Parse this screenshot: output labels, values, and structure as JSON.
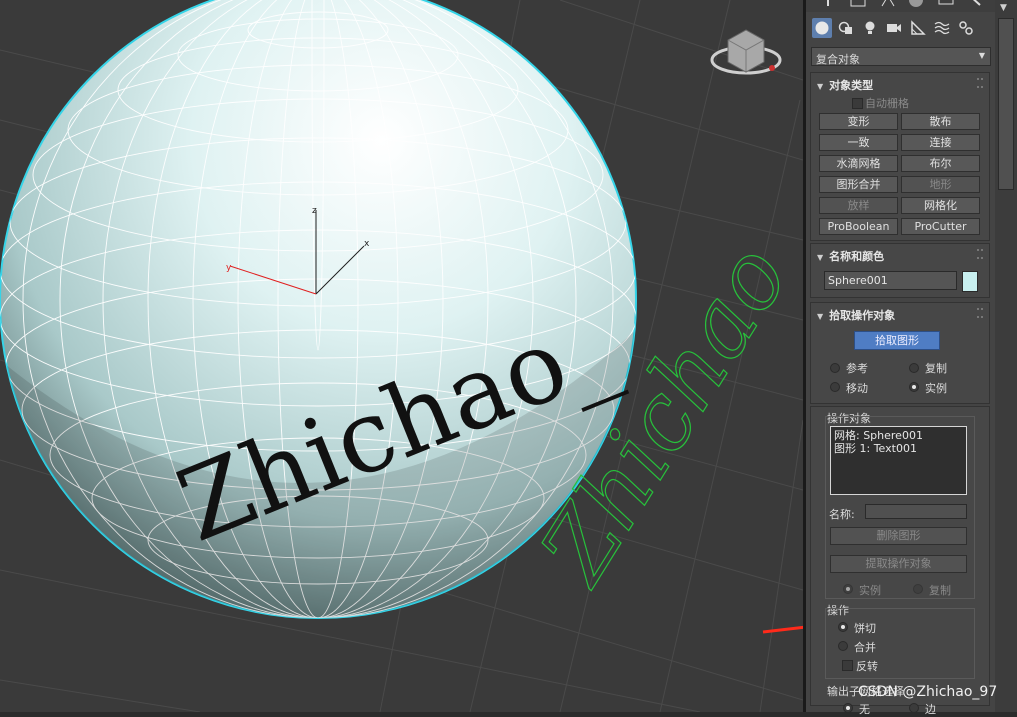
{
  "viewport": {
    "mesh_text": "Zhichao_",
    "shape_text": "Zhichao_",
    "gizmo_labels": {
      "z": "z",
      "x": "x",
      "y": "y"
    },
    "colors": {
      "sphere_outline": "#35d4e8",
      "shape_spline": "#27c13b",
      "arrow": "#ff2a1a"
    }
  },
  "command_panel": {
    "icons": [
      "sphere-icon",
      "shapes-icon",
      "light-icon",
      "camera-icon",
      "helper-icon",
      "spacewarp-icon",
      "systems-icon"
    ],
    "category_dropdown": "复合对象",
    "object_type": {
      "title": "对象类型",
      "autogrid": "自动栅格",
      "buttons": [
        {
          "label": "变形",
          "enabled": true
        },
        {
          "label": "散布",
          "enabled": true
        },
        {
          "label": "一致",
          "enabled": true
        },
        {
          "label": "连接",
          "enabled": true
        },
        {
          "label": "水滴网格",
          "enabled": true
        },
        {
          "label": "布尔",
          "enabled": true
        },
        {
          "label": "图形合并",
          "enabled": true
        },
        {
          "label": "地形",
          "enabled": false
        },
        {
          "label": "放样",
          "enabled": false
        },
        {
          "label": "网格化",
          "enabled": true
        },
        {
          "label": "ProBoolean",
          "enabled": true
        },
        {
          "label": "ProCutter",
          "enabled": true
        }
      ]
    },
    "name_color": {
      "title": "名称和颜色",
      "name_value": "Sphere001",
      "swatch_color": "#c8f0f0"
    },
    "pick_operand": {
      "title": "拾取操作对象",
      "pick_button": "拾取图形",
      "radios": {
        "reference": "参考",
        "copy": "复制",
        "move": "移动",
        "instance": "实例"
      },
      "selected": "instance"
    },
    "operands": {
      "title": "操作对象",
      "items": [
        "网格: Sphere001",
        "图形 1: Text001"
      ],
      "name_label": "名称:",
      "name_value": "",
      "delete_shape": "删除图形",
      "extract_operand": "提取操作对象",
      "instance": "实例",
      "copy": "复制"
    },
    "operations": {
      "title": "操作",
      "cookie_cutter": "饼切",
      "merge": "合并",
      "invert": "反转",
      "selected": "cookie_cutter"
    },
    "output_sub_mesh": {
      "title": "输出子网格选择",
      "none": "无",
      "edge": "边"
    }
  },
  "watermark": "CSDN @Zhichao_97"
}
